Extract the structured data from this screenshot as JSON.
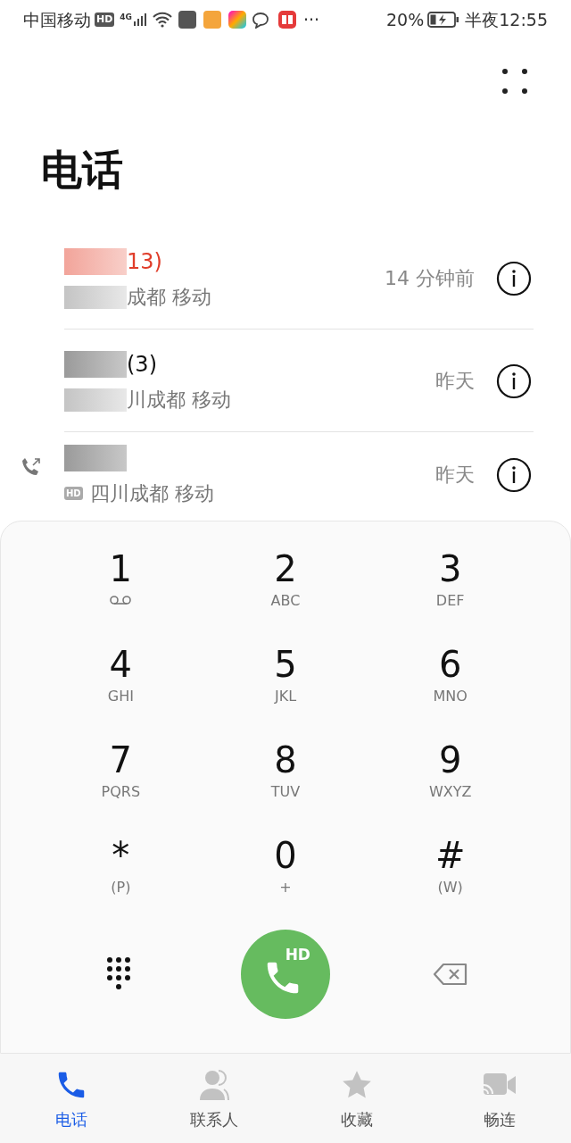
{
  "status_bar": {
    "carrier": "中国移动",
    "hd": "HD",
    "network": "4G",
    "more": "···",
    "battery": "20%",
    "charging": true,
    "time": "半夜12:55"
  },
  "title": "电话",
  "calls": [
    {
      "name_visible": "13)",
      "missed": true,
      "location_visible": "成都 移动",
      "outgoing": false,
      "time": "14 分钟前"
    },
    {
      "name_visible": "(3)",
      "missed": false,
      "location_visible": "川成都 移动",
      "outgoing": false,
      "time": "昨天"
    },
    {
      "missed": false,
      "hd_badge": "HD",
      "location_visible": "四川成都 移动",
      "outgoing": true,
      "time": "昨天"
    }
  ],
  "keypad": [
    {
      "digit": "1",
      "kind": "voicemail"
    },
    {
      "digit": "2",
      "kind": "letters",
      "sub": "ABC"
    },
    {
      "digit": "3",
      "kind": "letters",
      "sub": "DEF"
    },
    {
      "digit": "4",
      "kind": "letters",
      "sub": "GHI"
    },
    {
      "digit": "5",
      "kind": "letters",
      "sub": "JKL"
    },
    {
      "digit": "6",
      "kind": "letters",
      "sub": "MNO"
    },
    {
      "digit": "7",
      "kind": "letters",
      "sub": "PQRS"
    },
    {
      "digit": "8",
      "kind": "letters",
      "sub": "TUV"
    },
    {
      "digit": "9",
      "kind": "letters",
      "sub": "WXYZ"
    },
    {
      "digit": "*",
      "kind": "letters",
      "sub": "(P)"
    },
    {
      "digit": "0",
      "kind": "letters",
      "sub": "+"
    },
    {
      "digit": "#",
      "kind": "letters",
      "sub": "(W)"
    }
  ],
  "call_button": {
    "badge": "HD"
  },
  "tabs": [
    {
      "label": "电话",
      "selected": true
    },
    {
      "label": "联系人",
      "selected": false
    },
    {
      "label": "收藏",
      "selected": false
    },
    {
      "label": "畅连",
      "selected": false
    }
  ]
}
